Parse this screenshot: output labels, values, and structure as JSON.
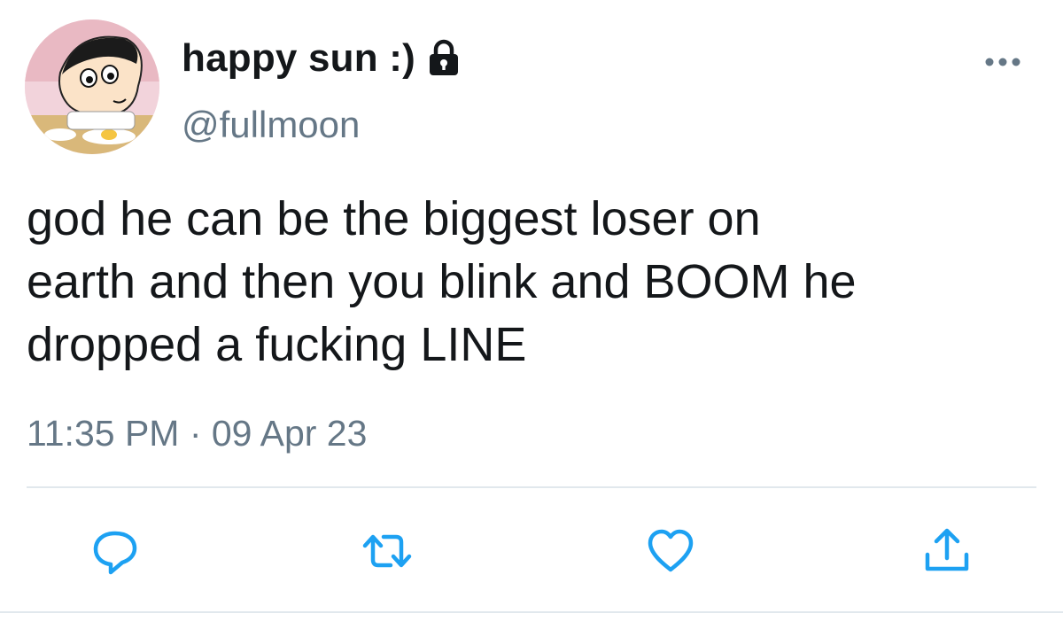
{
  "tweet": {
    "display_name": "happy sun :)",
    "handle": "@fullmoon",
    "text": "god he can be the biggest loser on\nearth and then you blink and BOOM he\ndropped a fucking LINE",
    "timestamp": "11:35 PM · 09 Apr 23",
    "protected": true
  },
  "icons": {
    "lock": "lock-icon",
    "more": "more-dots-icon",
    "reply": "reply-icon",
    "retweet": "retweet-icon",
    "like": "heart-icon",
    "share": "share-icon"
  },
  "colors": {
    "text": "#14171a",
    "secondary": "#657786",
    "accent": "#1da1f2",
    "divider": "#e1e8ed"
  }
}
